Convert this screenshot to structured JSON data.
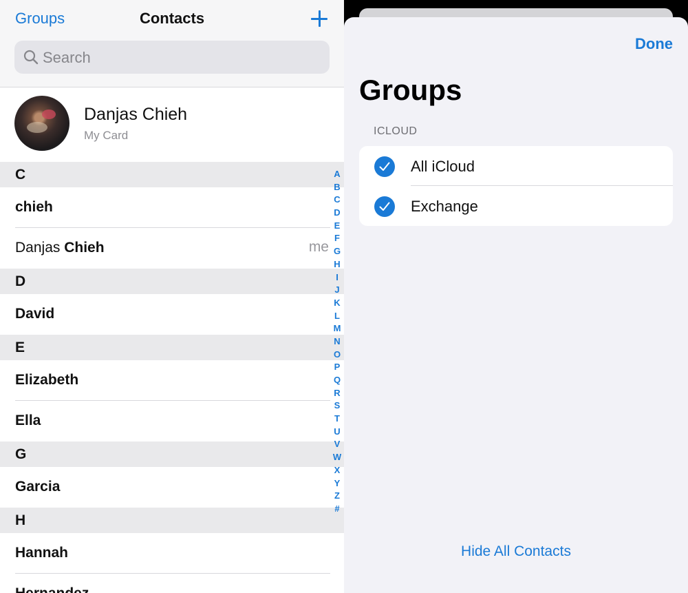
{
  "contacts": {
    "nav": {
      "groups_label": "Groups",
      "title": "Contacts"
    },
    "search": {
      "placeholder": "Search"
    },
    "my_card": {
      "name": "Danjas Chieh",
      "subtitle": "My Card"
    },
    "sections": [
      {
        "letter": "C",
        "rows": [
          {
            "text": "chieh",
            "style": "bold"
          },
          {
            "first": "Danjas",
            "last": "Chieh",
            "badge": "me"
          }
        ]
      },
      {
        "letter": "D",
        "rows": [
          {
            "text": "David",
            "style": "bold"
          }
        ]
      },
      {
        "letter": "E",
        "rows": [
          {
            "text": "Elizabeth",
            "style": "bold"
          },
          {
            "text": "Ella",
            "style": "bold"
          }
        ]
      },
      {
        "letter": "G",
        "rows": [
          {
            "text": "Garcia",
            "style": "bold"
          }
        ]
      },
      {
        "letter": "H",
        "rows": [
          {
            "text": "Hannah",
            "style": "bold"
          },
          {
            "text": "Hernandez",
            "style": "bold"
          }
        ]
      }
    ],
    "index_letters": [
      "A",
      "B",
      "C",
      "D",
      "E",
      "F",
      "G",
      "H",
      "I",
      "J",
      "K",
      "L",
      "M",
      "N",
      "O",
      "P",
      "Q",
      "R",
      "S",
      "T",
      "U",
      "V",
      "W",
      "X",
      "Y",
      "Z",
      "#"
    ]
  },
  "groups_sheet": {
    "done_label": "Done",
    "title": "Groups",
    "section_header": "ICLOUD",
    "items": [
      {
        "label": "All iCloud",
        "checked": true
      },
      {
        "label": "Exchange",
        "checked": true
      }
    ],
    "hide_all_label": "Hide All Contacts"
  },
  "colors": {
    "accent": "#1a7ad6",
    "section_bg": "#e9e9eb",
    "sheet_bg": "#f2f2f7"
  },
  "icons": [
    "search-icon",
    "plus-icon",
    "checkmark-icon"
  ]
}
